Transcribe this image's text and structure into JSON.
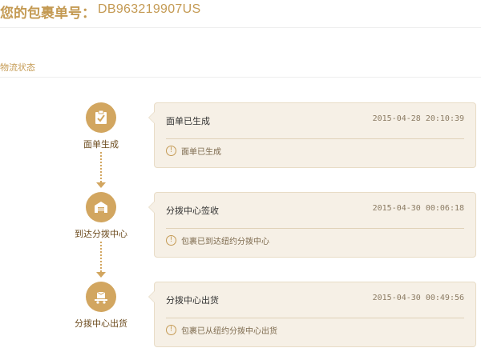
{
  "header": {
    "package_label": "您的包裹单号：",
    "package_number": "DB963219907US"
  },
  "section": {
    "title": "物流状态"
  },
  "timeline": [
    {
      "icon": "clipboard-check-icon",
      "step_label": "面单生成",
      "card_title": "面单已生成",
      "timestamp": "2015-04-28 20:10:39",
      "note_icon": "info-icon",
      "note_text": "面单已生成"
    },
    {
      "icon": "warehouse-icon",
      "step_label": "到达分拨中心",
      "card_title": "分拨中心签收",
      "timestamp": "2015-04-30 00:06:18",
      "note_icon": "info-icon",
      "note_text": "包裹已到达纽约分拨中心"
    },
    {
      "icon": "truck-box-icon",
      "step_label": "分拨中心出货",
      "card_title": "分拨中心出货",
      "timestamp": "2015-04-30 00:49:56",
      "note_icon": "info-icon",
      "note_text": "包裹已从纽约分拨中心出货"
    }
  ],
  "colors": {
    "accent": "#c49a53",
    "icon_bg": "#d2a660",
    "card_bg": "#f6f0e6",
    "card_border": "#e8dcc6"
  }
}
